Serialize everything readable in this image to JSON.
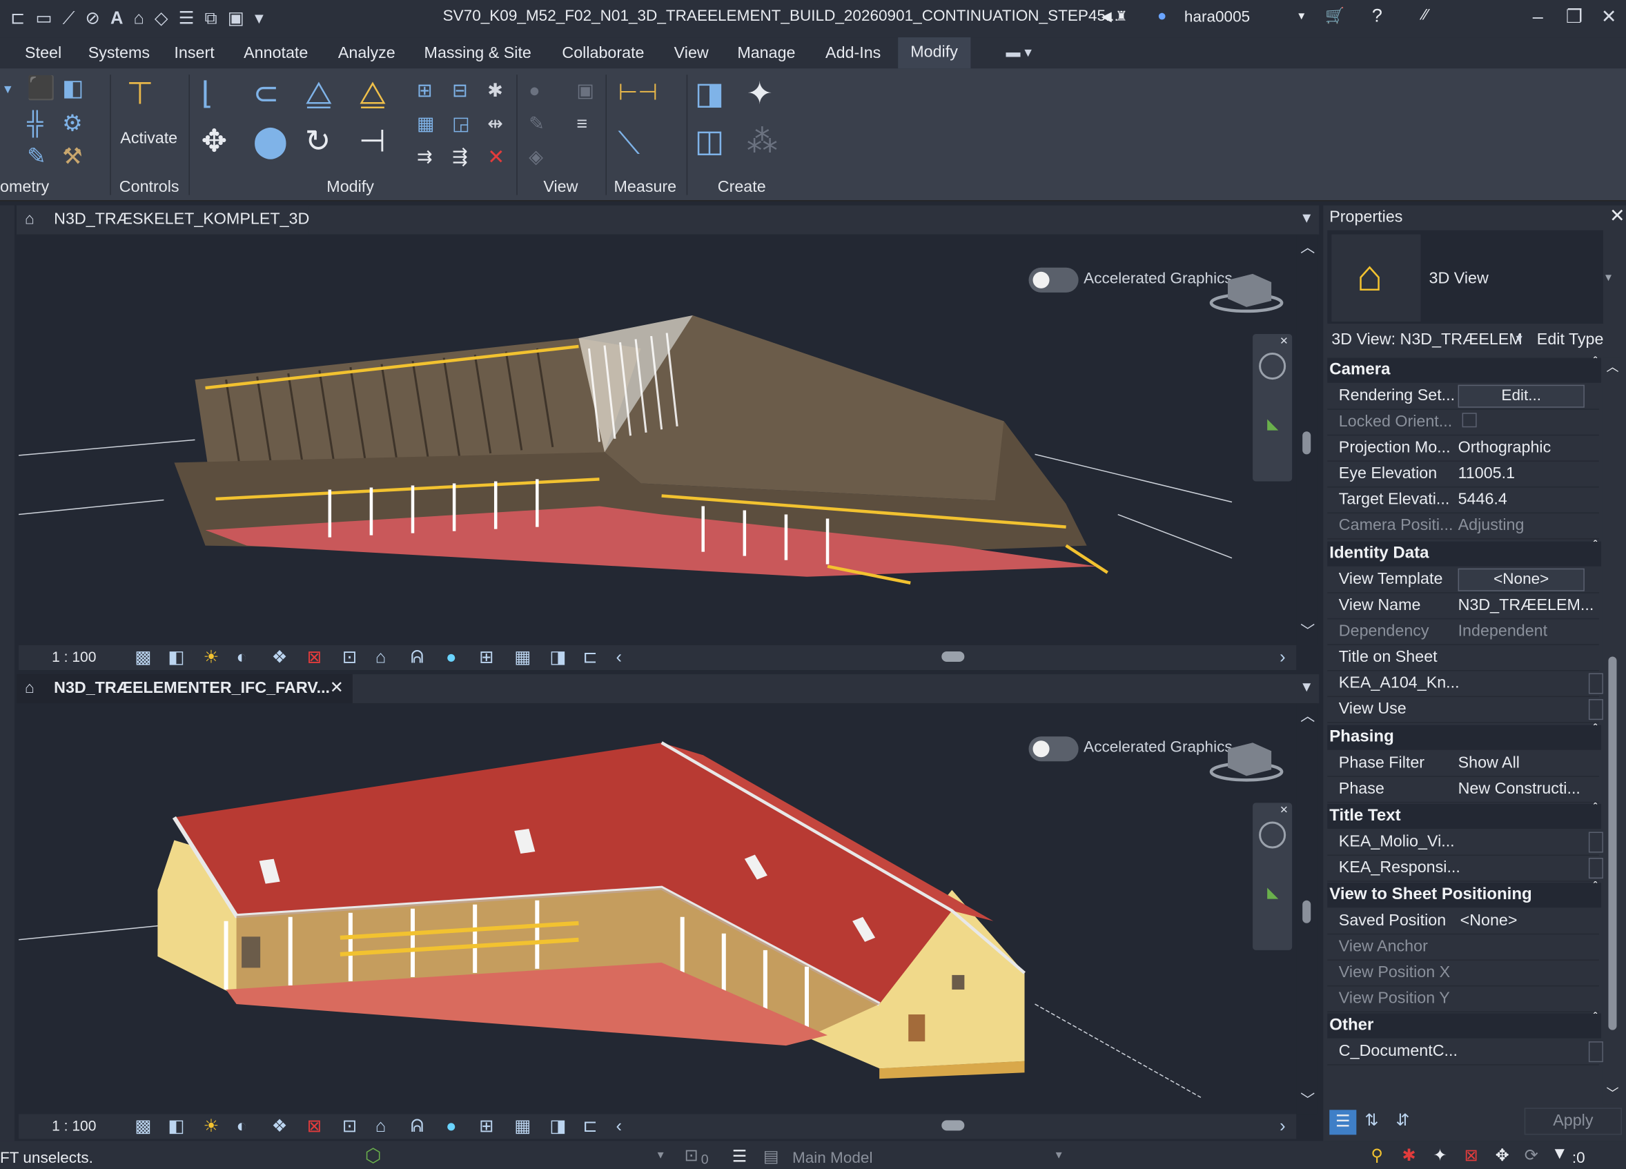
{
  "titlebar": {
    "doc_title": "SV70_K09_M52_F02_N01_3D_TRAEELEMENT_BUILD_20260901_CONTINUATION_STEP45...",
    "user": "hara0005"
  },
  "menu": [
    "Steel",
    "Systems",
    "Insert",
    "Annotate",
    "Analyze",
    "Massing & Site",
    "Collaborate",
    "View",
    "Manage",
    "Add-Ins",
    "Modify"
  ],
  "ribbon": {
    "activate_label": "Activate",
    "panels": [
      "ometry",
      "Controls",
      "Modify",
      "View",
      "Measure",
      "Create"
    ]
  },
  "views": [
    {
      "tab_label": "N3D_TRÆSKELET_KOMPLET_3D",
      "accel_label": "Accelerated Graphics",
      "scale": "1 : 100"
    },
    {
      "tab_label": "N3D_TRÆELEMENTER_IFC_FARV...",
      "accel_label": "Accelerated Graphics",
      "scale": "1 : 100"
    }
  ],
  "properties": {
    "panel_title": "Properties",
    "type_name": "3D View",
    "selector": "3D View: N3D_TRÆELEM",
    "edit_type": "Edit Type",
    "sections": {
      "camera": "Camera",
      "identity": "Identity Data",
      "phasing": "Phasing",
      "title_text": "Title Text",
      "view_to_sheet": "View to Sheet Positioning",
      "other": "Other"
    },
    "rows": {
      "rendering_settings": {
        "k": "Rendering Set...",
        "v": "Edit..."
      },
      "locked_orientation": {
        "k": "Locked Orient...",
        "v": ""
      },
      "projection_mode": {
        "k": "Projection Mo...",
        "v": "Orthographic"
      },
      "eye_elevation": {
        "k": "Eye Elevation",
        "v": "11005.1"
      },
      "target_elevation": {
        "k": "Target Elevati...",
        "v": "5446.4"
      },
      "camera_position": {
        "k": "Camera Positi...",
        "v": "Adjusting"
      },
      "view_template": {
        "k": "View Template",
        "v": "<None>"
      },
      "view_name": {
        "k": "View Name",
        "v": "N3D_TRÆELEM..."
      },
      "dependency": {
        "k": "Dependency",
        "v": "Independent"
      },
      "title_on_sheet": {
        "k": "Title on Sheet",
        "v": ""
      },
      "kea_a104": {
        "k": "KEA_A104_Kn...",
        "v": ""
      },
      "view_use": {
        "k": "View Use",
        "v": ""
      },
      "phase_filter": {
        "k": "Phase Filter",
        "v": "Show All"
      },
      "phase": {
        "k": "Phase",
        "v": "New Constructi..."
      },
      "kea_molio": {
        "k": "KEA_Molio_Vi...",
        "v": ""
      },
      "kea_responsible": {
        "k": "KEA_Responsi...",
        "v": ""
      },
      "saved_position": {
        "k": "Saved Position",
        "v": "<None>"
      },
      "view_anchor": {
        "k": "View Anchor",
        "v": ""
      },
      "view_position_x": {
        "k": "View Position X",
        "v": ""
      },
      "view_position_y": {
        "k": "View Position Y",
        "v": ""
      },
      "document_c": {
        "k": "C_DocumentC...",
        "v": ""
      }
    },
    "apply_label": "Apply"
  },
  "status": {
    "message": "FT unselects.",
    "model": "Main Model",
    "filter_count": ":0",
    "worksets_count": "0"
  },
  "colors": {
    "roof": "#b83a33",
    "wall": "#f0d98a",
    "timber": "#6b5c4a",
    "accent_yellow": "#f2c230",
    "bg": "#232833"
  }
}
